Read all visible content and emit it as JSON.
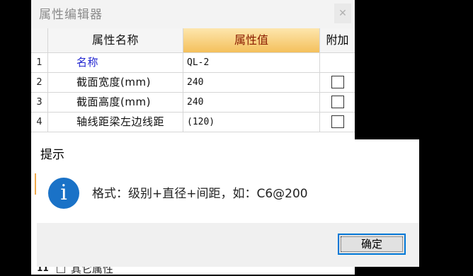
{
  "editor": {
    "title": "属性编辑器",
    "close_icon": "close-icon",
    "columns": {
      "index": "",
      "name": "属性名称",
      "value": "属性值",
      "attach": "附加"
    },
    "rows": [
      {
        "index": "1",
        "name": "名称",
        "value": "QL-2",
        "has_checkbox": false,
        "name_color": "#2024d0"
      },
      {
        "index": "2",
        "name": "截面宽度(mm)",
        "value": "240",
        "has_checkbox": true
      },
      {
        "index": "3",
        "name": "截面高度(mm)",
        "value": "240",
        "has_checkbox": true
      },
      {
        "index": "4",
        "name": "轴线距梁左边线距",
        "value": "(120)",
        "has_checkbox": true
      }
    ],
    "partial_row": {
      "index": "11",
      "label": "其它属性"
    }
  },
  "dialog": {
    "title": "提示",
    "icon": "info-icon",
    "message": "格式：级别+直径+间距，如：C6@200",
    "ok_label": "确定"
  },
  "colors": {
    "value_header_text": "#8a1c00",
    "accent": "#0078d7",
    "info_icon": "#1a72c7"
  }
}
